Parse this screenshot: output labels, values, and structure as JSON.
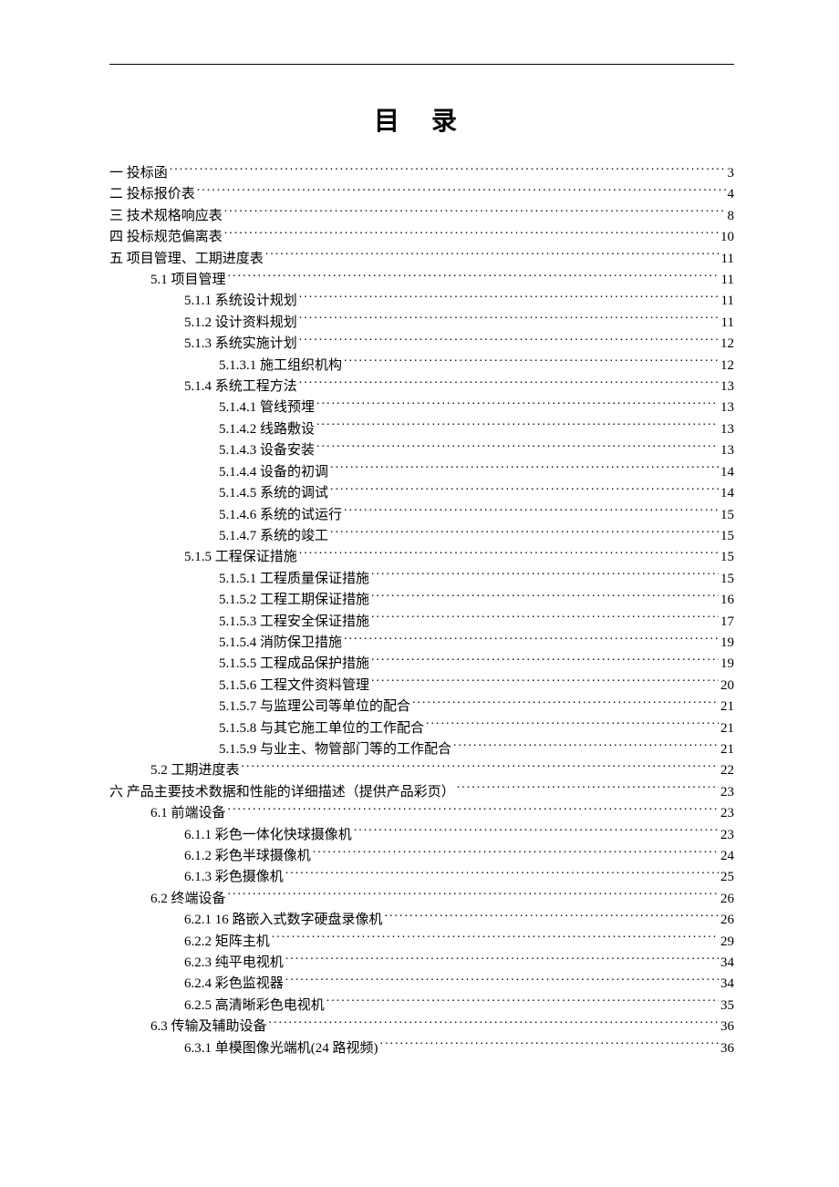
{
  "title": "目 录",
  "toc": [
    {
      "indent": 0,
      "label": "一  投标函",
      "page": "3"
    },
    {
      "indent": 0,
      "label": "二  投标报价表",
      "page": "4"
    },
    {
      "indent": 0,
      "label": "三  技术规格响应表",
      "page": "8"
    },
    {
      "indent": 0,
      "label": "四  投标规范偏离表",
      "page": "10"
    },
    {
      "indent": 0,
      "label": "五  项目管理、工期进度表",
      "page": "11"
    },
    {
      "indent": 1,
      "label": "5.1  项目管理",
      "page": "11"
    },
    {
      "indent": 2,
      "label": "5.1.1  系统设计规划",
      "page": "11"
    },
    {
      "indent": 2,
      "label": "5.1.2  设计资料规划",
      "page": "11"
    },
    {
      "indent": 2,
      "label": "5.1.3  系统实施计划",
      "page": "12"
    },
    {
      "indent": 3,
      "label": "5.1.3.1  施工组织机构",
      "page": "12"
    },
    {
      "indent": 2,
      "label": "5.1.4  系统工程方法",
      "page": "13"
    },
    {
      "indent": 3,
      "label": "5.1.4.1  管线预埋",
      "page": "13"
    },
    {
      "indent": 3,
      "label": "5.1.4.2  线路敷设",
      "page": "13"
    },
    {
      "indent": 3,
      "label": "5.1.4.3  设备安装",
      "page": "13"
    },
    {
      "indent": 3,
      "label": "5.1.4.4  设备的初调",
      "page": "14"
    },
    {
      "indent": 3,
      "label": "5.1.4.5  系统的调试",
      "page": "14"
    },
    {
      "indent": 3,
      "label": "5.1.4.6  系统的试运行",
      "page": "15"
    },
    {
      "indent": 3,
      "label": "5.1.4.7  系统的竣工",
      "page": "15"
    },
    {
      "indent": 2,
      "label": "5.1.5  工程保证措施",
      "page": "15"
    },
    {
      "indent": 3,
      "label": "5.1.5.1  工程质量保证措施",
      "page": "15"
    },
    {
      "indent": 3,
      "label": "5.1.5.2  工程工期保证措施",
      "page": "16"
    },
    {
      "indent": 3,
      "label": "5.1.5.3  工程安全保证措施",
      "page": "17"
    },
    {
      "indent": 3,
      "label": "5.1.5.4  消防保卫措施",
      "page": "19"
    },
    {
      "indent": 3,
      "label": "5.1.5.5  工程成品保护措施",
      "page": "19"
    },
    {
      "indent": 3,
      "label": "5.1.5.6  工程文件资料管理",
      "page": "20"
    },
    {
      "indent": 3,
      "label": "5.1.5.7  与监理公司等单位的配合",
      "page": "21"
    },
    {
      "indent": 3,
      "label": "5.1.5.8  与其它施工单位的工作配合",
      "page": "21"
    },
    {
      "indent": 3,
      "label": "5.1.5.9  与业主、物管部门等的工作配合",
      "page": "21"
    },
    {
      "indent": 1,
      "label": "5.2  工期进度表",
      "page": "22"
    },
    {
      "indent": 0,
      "label": "六  产品主要技术数据和性能的详细描述（提供产品彩页）",
      "page": "23"
    },
    {
      "indent": 1,
      "label": "6.1  前端设备",
      "page": "23"
    },
    {
      "indent": 2,
      "label": "6.1.1  彩色一体化快球摄像机",
      "page": "23"
    },
    {
      "indent": 2,
      "label": "6.1.2  彩色半球摄像机",
      "page": "24"
    },
    {
      "indent": 2,
      "label": "6.1.3  彩色摄像机",
      "page": "25"
    },
    {
      "indent": 1,
      "label": "6.2  终端设备",
      "page": "26"
    },
    {
      "indent": 2,
      "label": "6.2.1 16 路嵌入式数字硬盘录像机",
      "page": "26"
    },
    {
      "indent": 2,
      "label": "6.2.2  矩阵主机",
      "page": "29"
    },
    {
      "indent": 2,
      "label": "6.2.3  纯平电视机",
      "page": "34"
    },
    {
      "indent": 2,
      "label": "6.2.4  彩色监视器",
      "page": "34"
    },
    {
      "indent": 2,
      "label": "6.2.5  高清晰彩色电视机",
      "page": "35"
    },
    {
      "indent": 1,
      "label": "6.3  传输及辅助设备",
      "page": "36"
    },
    {
      "indent": 2,
      "label": "6.3.1  单模图像光端机(24 路视频)",
      "page": "36"
    }
  ]
}
